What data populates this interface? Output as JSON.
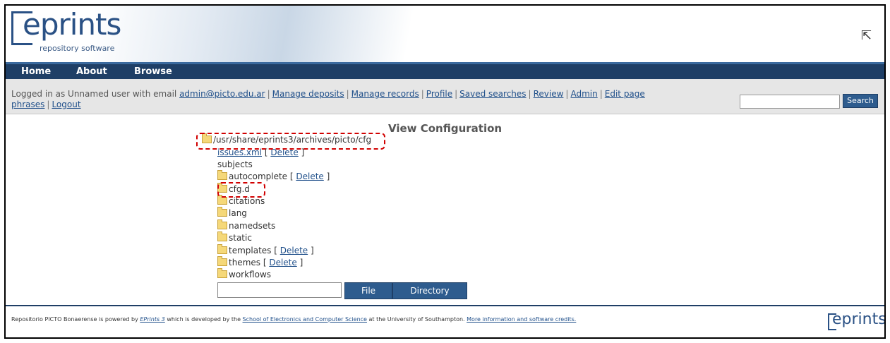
{
  "brand": {
    "word": "eprints",
    "tagline": "repository software",
    "footer_word": "eprints"
  },
  "nav": {
    "items": [
      {
        "label": "Home"
      },
      {
        "label": "About"
      },
      {
        "label": "Browse"
      }
    ]
  },
  "userbar": {
    "prefix": "Logged in as Unnamed user with email",
    "email": "admin@picto.edu.ar",
    "links": [
      "Manage deposits",
      "Manage records",
      "Profile",
      "Saved searches",
      "Review",
      "Admin",
      "Edit page phrases",
      "Logout"
    ],
    "search_label": "Search",
    "search_value": ""
  },
  "page": {
    "title": "View Configuration"
  },
  "tree": {
    "root": "/usr/share/eprints3/archives/picto/cfg",
    "file": "issues.xml",
    "delete_label": "Delete",
    "plain": "subjects",
    "folders": [
      "autocomplete",
      "cfg.d",
      "citations",
      "lang",
      "namedsets",
      "static",
      "templates",
      "themes",
      "workflows"
    ]
  },
  "create": {
    "name_value": "",
    "file_label": "File",
    "directory_label": "Directory"
  },
  "footer": {
    "part1": "Repositorio PICTO Bonaerense is powered by",
    "eprints_link": "EPrints 3",
    "part2": "which is developed by the",
    "school_link": "School of Electronics and Computer Science",
    "part3": "at the University of Southampton.",
    "credits_link": "More information and software credits."
  }
}
